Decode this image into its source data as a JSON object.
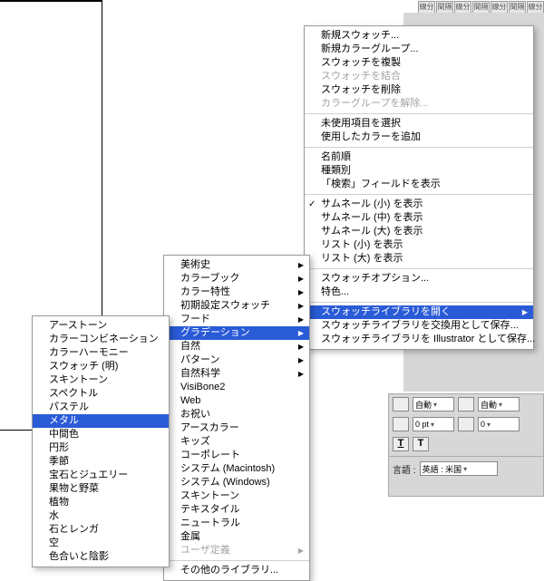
{
  "toolbar_tabs": [
    "線分",
    "間隔",
    "線分",
    "間隔",
    "線分",
    "間隔",
    "線分"
  ],
  "menu1": {
    "groups": [
      [
        {
          "label": "新規スウォッチ...",
          "sub": false
        },
        {
          "label": "新規カラーグループ...",
          "sub": false
        },
        {
          "label": "スウォッチを複製",
          "sub": false
        },
        {
          "label": "スウォッチを結合",
          "sub": false,
          "dis": true
        },
        {
          "label": "スウォッチを削除",
          "sub": false
        },
        {
          "label": "カラーグループを解除...",
          "sub": false,
          "dis": true
        }
      ],
      [
        {
          "label": "未使用項目を選択",
          "sub": false
        },
        {
          "label": "使用したカラーを追加",
          "sub": false
        }
      ],
      [
        {
          "label": "名前順",
          "sub": false
        },
        {
          "label": "種類別",
          "sub": false
        },
        {
          "label": "「検索」フィールドを表示",
          "sub": false
        }
      ],
      [
        {
          "label": "サムネール (小) を表示",
          "sub": false,
          "check": true
        },
        {
          "label": "サムネール (中) を表示",
          "sub": false
        },
        {
          "label": "サムネール (大) を表示",
          "sub": false
        },
        {
          "label": "リスト (小) を表示",
          "sub": false
        },
        {
          "label": "リスト (大) を表示",
          "sub": false
        }
      ],
      [
        {
          "label": "スウォッチオプション...",
          "sub": false
        },
        {
          "label": "特色...",
          "sub": false
        }
      ],
      [
        {
          "label": "スウォッチライブラリを開く",
          "sub": true,
          "sel": true
        },
        {
          "label": "スウォッチライブラリを交換用として保存...",
          "sub": false
        },
        {
          "label": "スウォッチライブラリを Illustrator として保存...",
          "sub": false
        }
      ]
    ]
  },
  "menu2": {
    "groups": [
      [
        {
          "label": "美術史",
          "sub": true
        },
        {
          "label": "カラーブック",
          "sub": true
        },
        {
          "label": "カラー特性",
          "sub": true
        },
        {
          "label": "初期設定スウォッチ",
          "sub": true
        },
        {
          "label": "フード",
          "sub": true
        },
        {
          "label": "グラデーション",
          "sub": true,
          "sel": true
        },
        {
          "label": "自然",
          "sub": true
        },
        {
          "label": "パターン",
          "sub": true
        },
        {
          "label": "自然科学",
          "sub": true
        },
        {
          "label": "VisiBone2",
          "sub": false
        },
        {
          "label": "Web",
          "sub": false
        },
        {
          "label": "お祝い",
          "sub": false
        },
        {
          "label": "アースカラー",
          "sub": false
        },
        {
          "label": "キッズ",
          "sub": false
        },
        {
          "label": "コーポレート",
          "sub": false
        },
        {
          "label": "システム (Macintosh)",
          "sub": false
        },
        {
          "label": "システム (Windows)",
          "sub": false
        },
        {
          "label": "スキントーン",
          "sub": false
        },
        {
          "label": "テキスタイル",
          "sub": false
        },
        {
          "label": "ニュートラル",
          "sub": false
        },
        {
          "label": "金属",
          "sub": false
        },
        {
          "label": "ユーザ定義",
          "sub": true,
          "dis": true
        }
      ],
      [
        {
          "label": "その他のライブラリ...",
          "sub": false
        }
      ]
    ]
  },
  "menu3": {
    "items": [
      "アーストーン",
      "カラーコンビネーション",
      "カラーハーモニー",
      "スウォッチ (明)",
      "スキントーン",
      "スペクトル",
      "パステル"
    ],
    "sel": "メタル",
    "items2": [
      "中間色",
      "円形",
      "季節",
      "宝石とジュエリー",
      "果物と野菜",
      "植物",
      "水",
      "石とレンガ",
      "空",
      "色合いと陰影"
    ]
  },
  "bottom_panel": {
    "auto": "自動",
    "pt_value": "0 pt",
    "zero": "0",
    "lang_label": "言語 :",
    "lang_value": "英語 : 米国"
  }
}
